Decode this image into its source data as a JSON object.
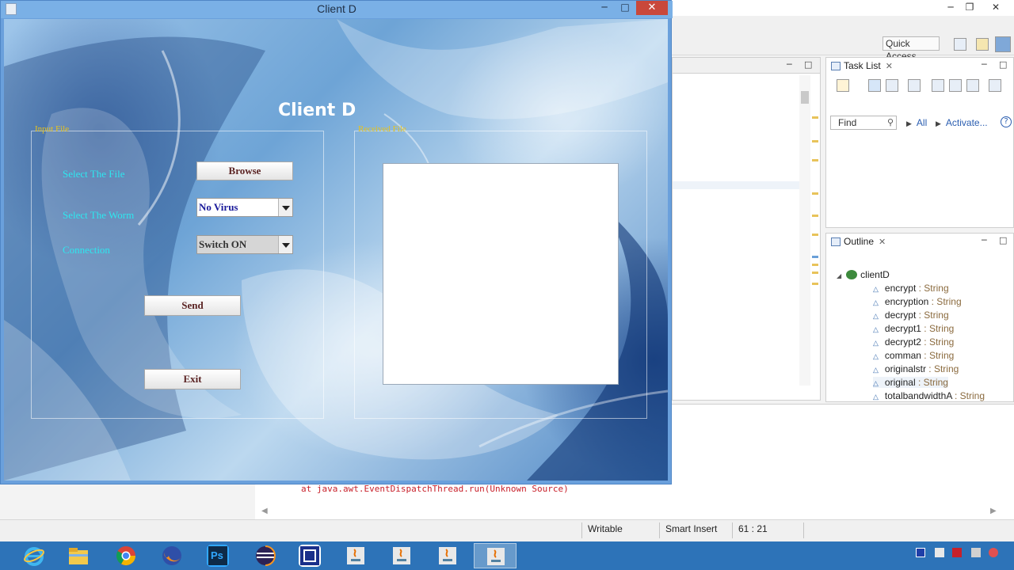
{
  "client_window": {
    "title": "Client D",
    "heading": "Client D",
    "controls": {
      "minimize": "─",
      "maximize": "□",
      "close": "✕"
    },
    "input_group": {
      "title": "Input File",
      "select_file_label": "Select The File",
      "browse_button": "Browse",
      "select_worm_label": "Select The Worm",
      "worm_selected": "No Virus",
      "connection_label": "Connection",
      "connection_selected": "Switch ON",
      "send_button": "Send",
      "exit_button": "Exit"
    },
    "received_group": {
      "title": "Received File",
      "content": ""
    }
  },
  "eclipse": {
    "window_controls": {
      "minimize": "─",
      "maximize": "❐",
      "close": "✕"
    },
    "quick_access": "Quick Access",
    "task_list": {
      "title": "Task List",
      "find_placeholder": "Find",
      "filter_all": "All",
      "filter_activate": "Activate...",
      "help": "?"
    },
    "outline": {
      "title": "Outline",
      "root": "clientD",
      "items": [
        {
          "name": "encrypt",
          "type": ": String"
        },
        {
          "name": "encryption",
          "type": ": String"
        },
        {
          "name": "decrypt",
          "type": ": String"
        },
        {
          "name": "decrypt1",
          "type": ": String"
        },
        {
          "name": "decrypt2",
          "type": ": String"
        },
        {
          "name": "comman",
          "type": ": String"
        },
        {
          "name": "originalstr",
          "type": ": String"
        },
        {
          "name": "original",
          "type": ": String"
        },
        {
          "name": "totalbandwidthA",
          "type": ": String"
        }
      ]
    },
    "console": {
      "line": "at java.awt.EventDispatchThread.run(Unknown Source)"
    },
    "status": {
      "writable": "Writable",
      "insert_mode": "Smart Insert",
      "position": "61 : 21"
    }
  },
  "taskbar": {
    "icons": [
      "internet-explorer-icon",
      "file-explorer-icon",
      "chrome-icon",
      "firefox-icon",
      "photoshop-icon",
      "eclipse-icon",
      "app-icon",
      "java-icon",
      "java-icon",
      "java-icon",
      "java-icon"
    ],
    "photoshop_label": "Ps"
  },
  "colors": {
    "label_cyan": "#2ee7ef",
    "group_title_yellow": "#e8c31c",
    "button_text": "#5a2323",
    "combo_worm_text": "#1a1a9a",
    "taskbar": "#2d73b8"
  }
}
